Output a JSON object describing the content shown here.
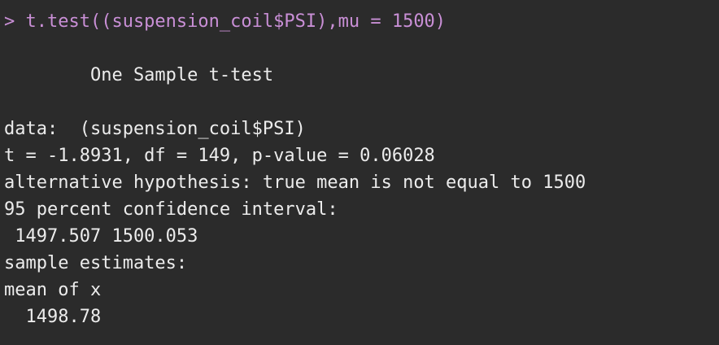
{
  "console": {
    "command_line": "> t.test((suspension_coil$PSI),mu = 1500)",
    "output_lines": [
      "",
      "        One Sample t-test",
      "",
      "data:  (suspension_coil$PSI)",
      "t = -1.8931, df = 149, p-value = 0.06028",
      "alternative hypothesis: true mean is not equal to 1500",
      "95 percent confidence interval:",
      " 1497.507 1500.053",
      "sample estimates:",
      "mean of x",
      "  1498.78"
    ]
  },
  "colors": {
    "background": "#2b2b2b",
    "command": "#c98fd6",
    "output": "#ececec"
  }
}
